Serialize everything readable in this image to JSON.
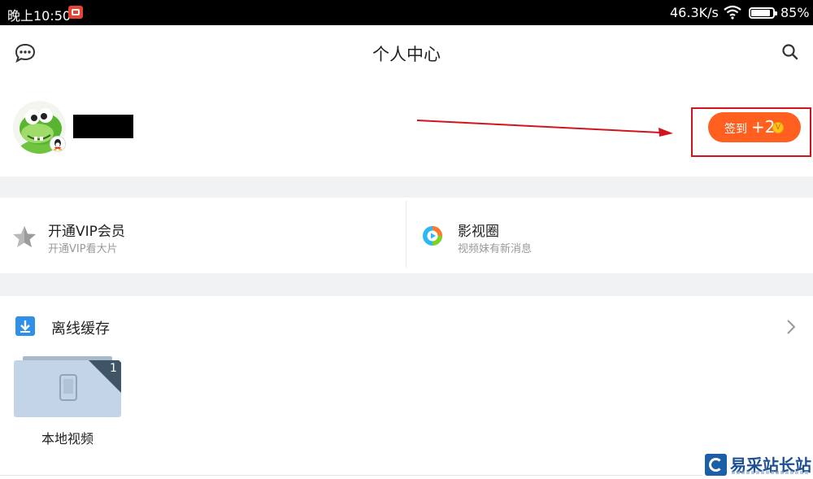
{
  "status_bar": {
    "time": "晚上10:50",
    "net_speed": "46.3K/s",
    "battery": "85%"
  },
  "header": {
    "title": "个人中心",
    "left_icon": "message-icon",
    "right_icon": "search-icon"
  },
  "profile": {
    "avatar_icon": "dinosaur-avatar",
    "username": "",
    "username_redacted": true,
    "checkin_label": "签到",
    "checkin_bonus": "+2",
    "coin_symbol": "V",
    "accent_color": "#ff5f1f",
    "annotation_color": "#d2141e"
  },
  "quick_cards": [
    {
      "icon": "vip-star-icon",
      "title": "开通VIP会员",
      "subtitle": "开通VIP看大片"
    },
    {
      "icon": "video-circle-icon",
      "title": "影视圈",
      "subtitle": "视频妹有新消息"
    }
  ],
  "offline": {
    "heading": "离线缓存",
    "icon": "download-icon",
    "folder": {
      "label": "本地视频",
      "count": "1",
      "icon": "phone-icon"
    }
  },
  "watermark": {
    "name": "易采站长站"
  }
}
